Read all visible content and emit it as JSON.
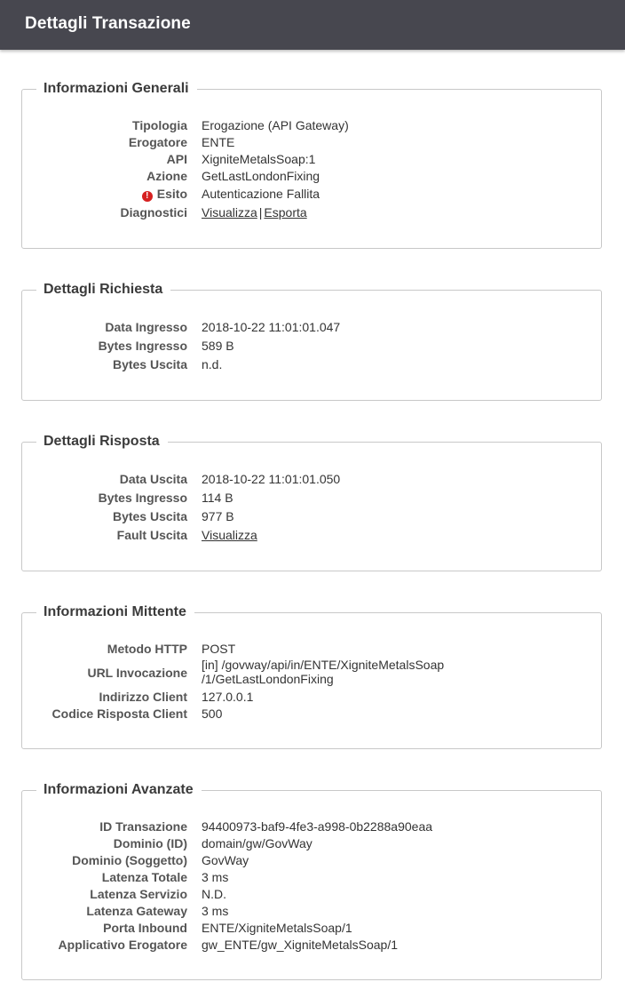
{
  "header": {
    "title": "Dettagli Transazione"
  },
  "generali": {
    "legend": "Informazioni Generali",
    "tipologia": {
      "label": "Tipologia",
      "value": "Erogazione (API Gateway)"
    },
    "erogatore": {
      "label": "Erogatore",
      "value": "ENTE"
    },
    "api": {
      "label": "API",
      "value": "XigniteMetalsSoap:1"
    },
    "azione": {
      "label": "Azione",
      "value": "GetLastLondonFixing"
    },
    "esito": {
      "label": "Esito",
      "value": "Autenticazione Fallita",
      "icon": "error-icon",
      "icon_glyph": "!"
    },
    "diagnostici": {
      "label": "Diagnostici",
      "visualizza": "Visualizza",
      "separator": "|",
      "esporta": "Esporta"
    }
  },
  "richiesta": {
    "legend": "Dettagli Richiesta",
    "data_ingresso": {
      "label": "Data Ingresso",
      "value": "2018-10-22 11:01:01.047"
    },
    "bytes_ingresso": {
      "label": "Bytes Ingresso",
      "value": "589 B"
    },
    "bytes_uscita": {
      "label": "Bytes Uscita",
      "value": "n.d."
    }
  },
  "risposta": {
    "legend": "Dettagli Risposta",
    "data_uscita": {
      "label": "Data Uscita",
      "value": "2018-10-22 11:01:01.050"
    },
    "bytes_ingresso": {
      "label": "Bytes Ingresso",
      "value": "114 B"
    },
    "bytes_uscita": {
      "label": "Bytes Uscita",
      "value": "977 B"
    },
    "fault_uscita": {
      "label": "Fault Uscita",
      "value": "Visualizza"
    }
  },
  "mittente": {
    "legend": "Informazioni Mittente",
    "metodo_http": {
      "label": "Metodo HTTP",
      "value": "POST"
    },
    "url_invocazione": {
      "label": "URL Invocazione",
      "value_line1": "[in] /govway/api/in/ENTE/XigniteMetalsSoap",
      "value_line2": "/1/GetLastLondonFixing"
    },
    "indirizzo_client": {
      "label": "Indirizzo Client",
      "value": "127.0.0.1"
    },
    "codice_risposta_client": {
      "label": "Codice Risposta Client",
      "value": "500"
    }
  },
  "avanzate": {
    "legend": "Informazioni Avanzate",
    "id_transazione": {
      "label": "ID Transazione",
      "value": "94400973-baf9-4fe3-a998-0b2288a90eaa"
    },
    "dominio_id": {
      "label": "Dominio (ID)",
      "value": "domain/gw/GovWay"
    },
    "dominio_soggetto": {
      "label": "Dominio (Soggetto)",
      "value": "GovWay"
    },
    "latenza_totale": {
      "label": "Latenza Totale",
      "value": "3 ms"
    },
    "latenza_servizio": {
      "label": "Latenza Servizio",
      "value": "N.D."
    },
    "latenza_gateway": {
      "label": "Latenza Gateway",
      "value": "3 ms"
    },
    "porta_inbound": {
      "label": "Porta Inbound",
      "value": "ENTE/XigniteMetalsSoap/1"
    },
    "applicativo_erogatore": {
      "label": "Applicativo Erogatore",
      "value": "gw_ENTE/gw_XigniteMetalsSoap/1"
    }
  },
  "colors": {
    "topbar": "#47474f",
    "error": "#d62020",
    "border": "#c8c8c8"
  }
}
